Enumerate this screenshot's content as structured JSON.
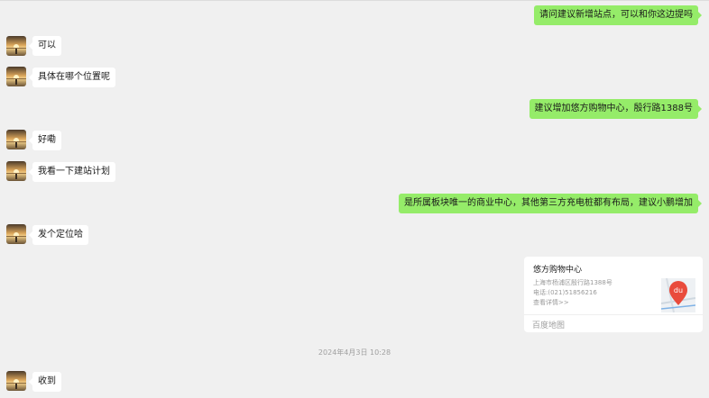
{
  "messages": [
    {
      "side": "out",
      "text": "请问建议新增站点，可以和你这边提吗"
    },
    {
      "side": "in",
      "text": "可以"
    },
    {
      "side": "in",
      "text": "具体在哪个位置呢"
    },
    {
      "side": "out",
      "text": "建议增加悠方购物中心，殷行路1388号"
    },
    {
      "side": "in",
      "text": "好嘞"
    },
    {
      "side": "in",
      "text": "我看一下建站计划"
    },
    {
      "side": "out",
      "text": "是所属板块唯一的商业中心，其他第三方充电桩都有布局，建议小鹏增加"
    },
    {
      "side": "in",
      "text": "发个定位哈"
    },
    {
      "side": "in",
      "text": "收到"
    }
  ],
  "location_card": {
    "name": "悠方购物中心",
    "address": "上海市杨浦区殷行路1388号",
    "phone": "电话:(021)51856216",
    "details_link": "查看详情>>",
    "source": "百度地图",
    "map_badge": "du",
    "map_badge_color": "#e94b3c"
  },
  "timestamp": "2024年4月3日 10:28",
  "colors": {
    "background": "#f0f0f0",
    "outgoing_bubble": "#95ec69",
    "incoming_bubble": "#ffffff"
  }
}
